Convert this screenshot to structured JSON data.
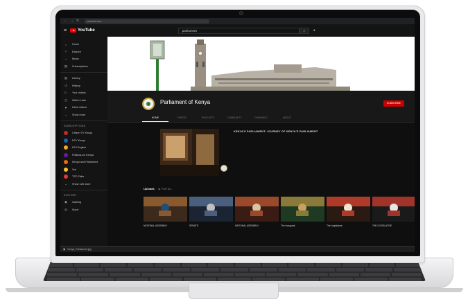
{
  "browser": {
    "url": "youtube.com"
  },
  "header": {
    "logo_text": "YouTube",
    "search_value": "parliament"
  },
  "sidebar": {
    "primary": [
      {
        "icon": "home-icon",
        "label": "Home"
      },
      {
        "icon": "explore-icon",
        "label": "Explore"
      },
      {
        "icon": "music-icon",
        "label": "Music"
      },
      {
        "icon": "subscriptions-icon",
        "label": "Subscriptions"
      }
    ],
    "library": [
      {
        "icon": "library-icon",
        "label": "Library"
      },
      {
        "icon": "history-icon",
        "label": "History"
      },
      {
        "icon": "your-videos-icon",
        "label": "Your videos"
      },
      {
        "icon": "watch-later-icon",
        "label": "Watch Later"
      },
      {
        "icon": "liked-videos-icon",
        "label": "Liked videos"
      },
      {
        "icon": "show-more-icon",
        "label": "Show more"
      }
    ],
    "subscriptions_heading": "SUBSCRIPTIONS",
    "subscriptions": [
      {
        "label": "Citizen TV Kenya",
        "color": "#c62828"
      },
      {
        "label": "NTV Kenya",
        "color": "#1565c0"
      },
      {
        "label": "K24 English",
        "color": "#f9a825"
      },
      {
        "label": "PoliticsLive Kenya",
        "color": "#6a1b9a"
      },
      {
        "label": "Kenya and Parliament",
        "color": "#ef6c00"
      },
      {
        "label": "Vox",
        "color": "#fbc02d"
      },
      {
        "label": "TED Talks",
        "color": "#e53935"
      }
    ],
    "show_more": "Show 126 more",
    "explore_heading": "EXPLORE",
    "explore": [
      {
        "icon": "gaming-icon",
        "label": "Gaming"
      },
      {
        "icon": "sport-icon",
        "label": "Sport"
      }
    ]
  },
  "channel": {
    "name": "Parliament of Kenya",
    "subscribe_label": "SUBSCRIBE",
    "tabs": [
      "HOME",
      "VIDEOS",
      "PLAYLISTS",
      "COMMUNITY",
      "CHANNELS",
      "ABOUT"
    ],
    "featured_title": "KENYA'S PARLIAMENT: JOURNEY OF KENYA'S PARLIAMENT",
    "shelf_title": "Uploads",
    "shelf_action": "PLAY ALL",
    "videos": [
      {
        "title": "NATIONAL ASSEMBLY"
      },
      {
        "title": "SENATE"
      },
      {
        "title": "NATIONAL ASSEMBLY"
      },
      {
        "title": "The Inaugural"
      },
      {
        "title": "The Legislature"
      },
      {
        "title": "THE LEGISLATIVE"
      }
    ]
  },
  "taskbar": {
    "file": "Kenya_Parliament.jpg"
  },
  "colors": {
    "accent": "#cc0000",
    "background": "#0f0f0f"
  }
}
